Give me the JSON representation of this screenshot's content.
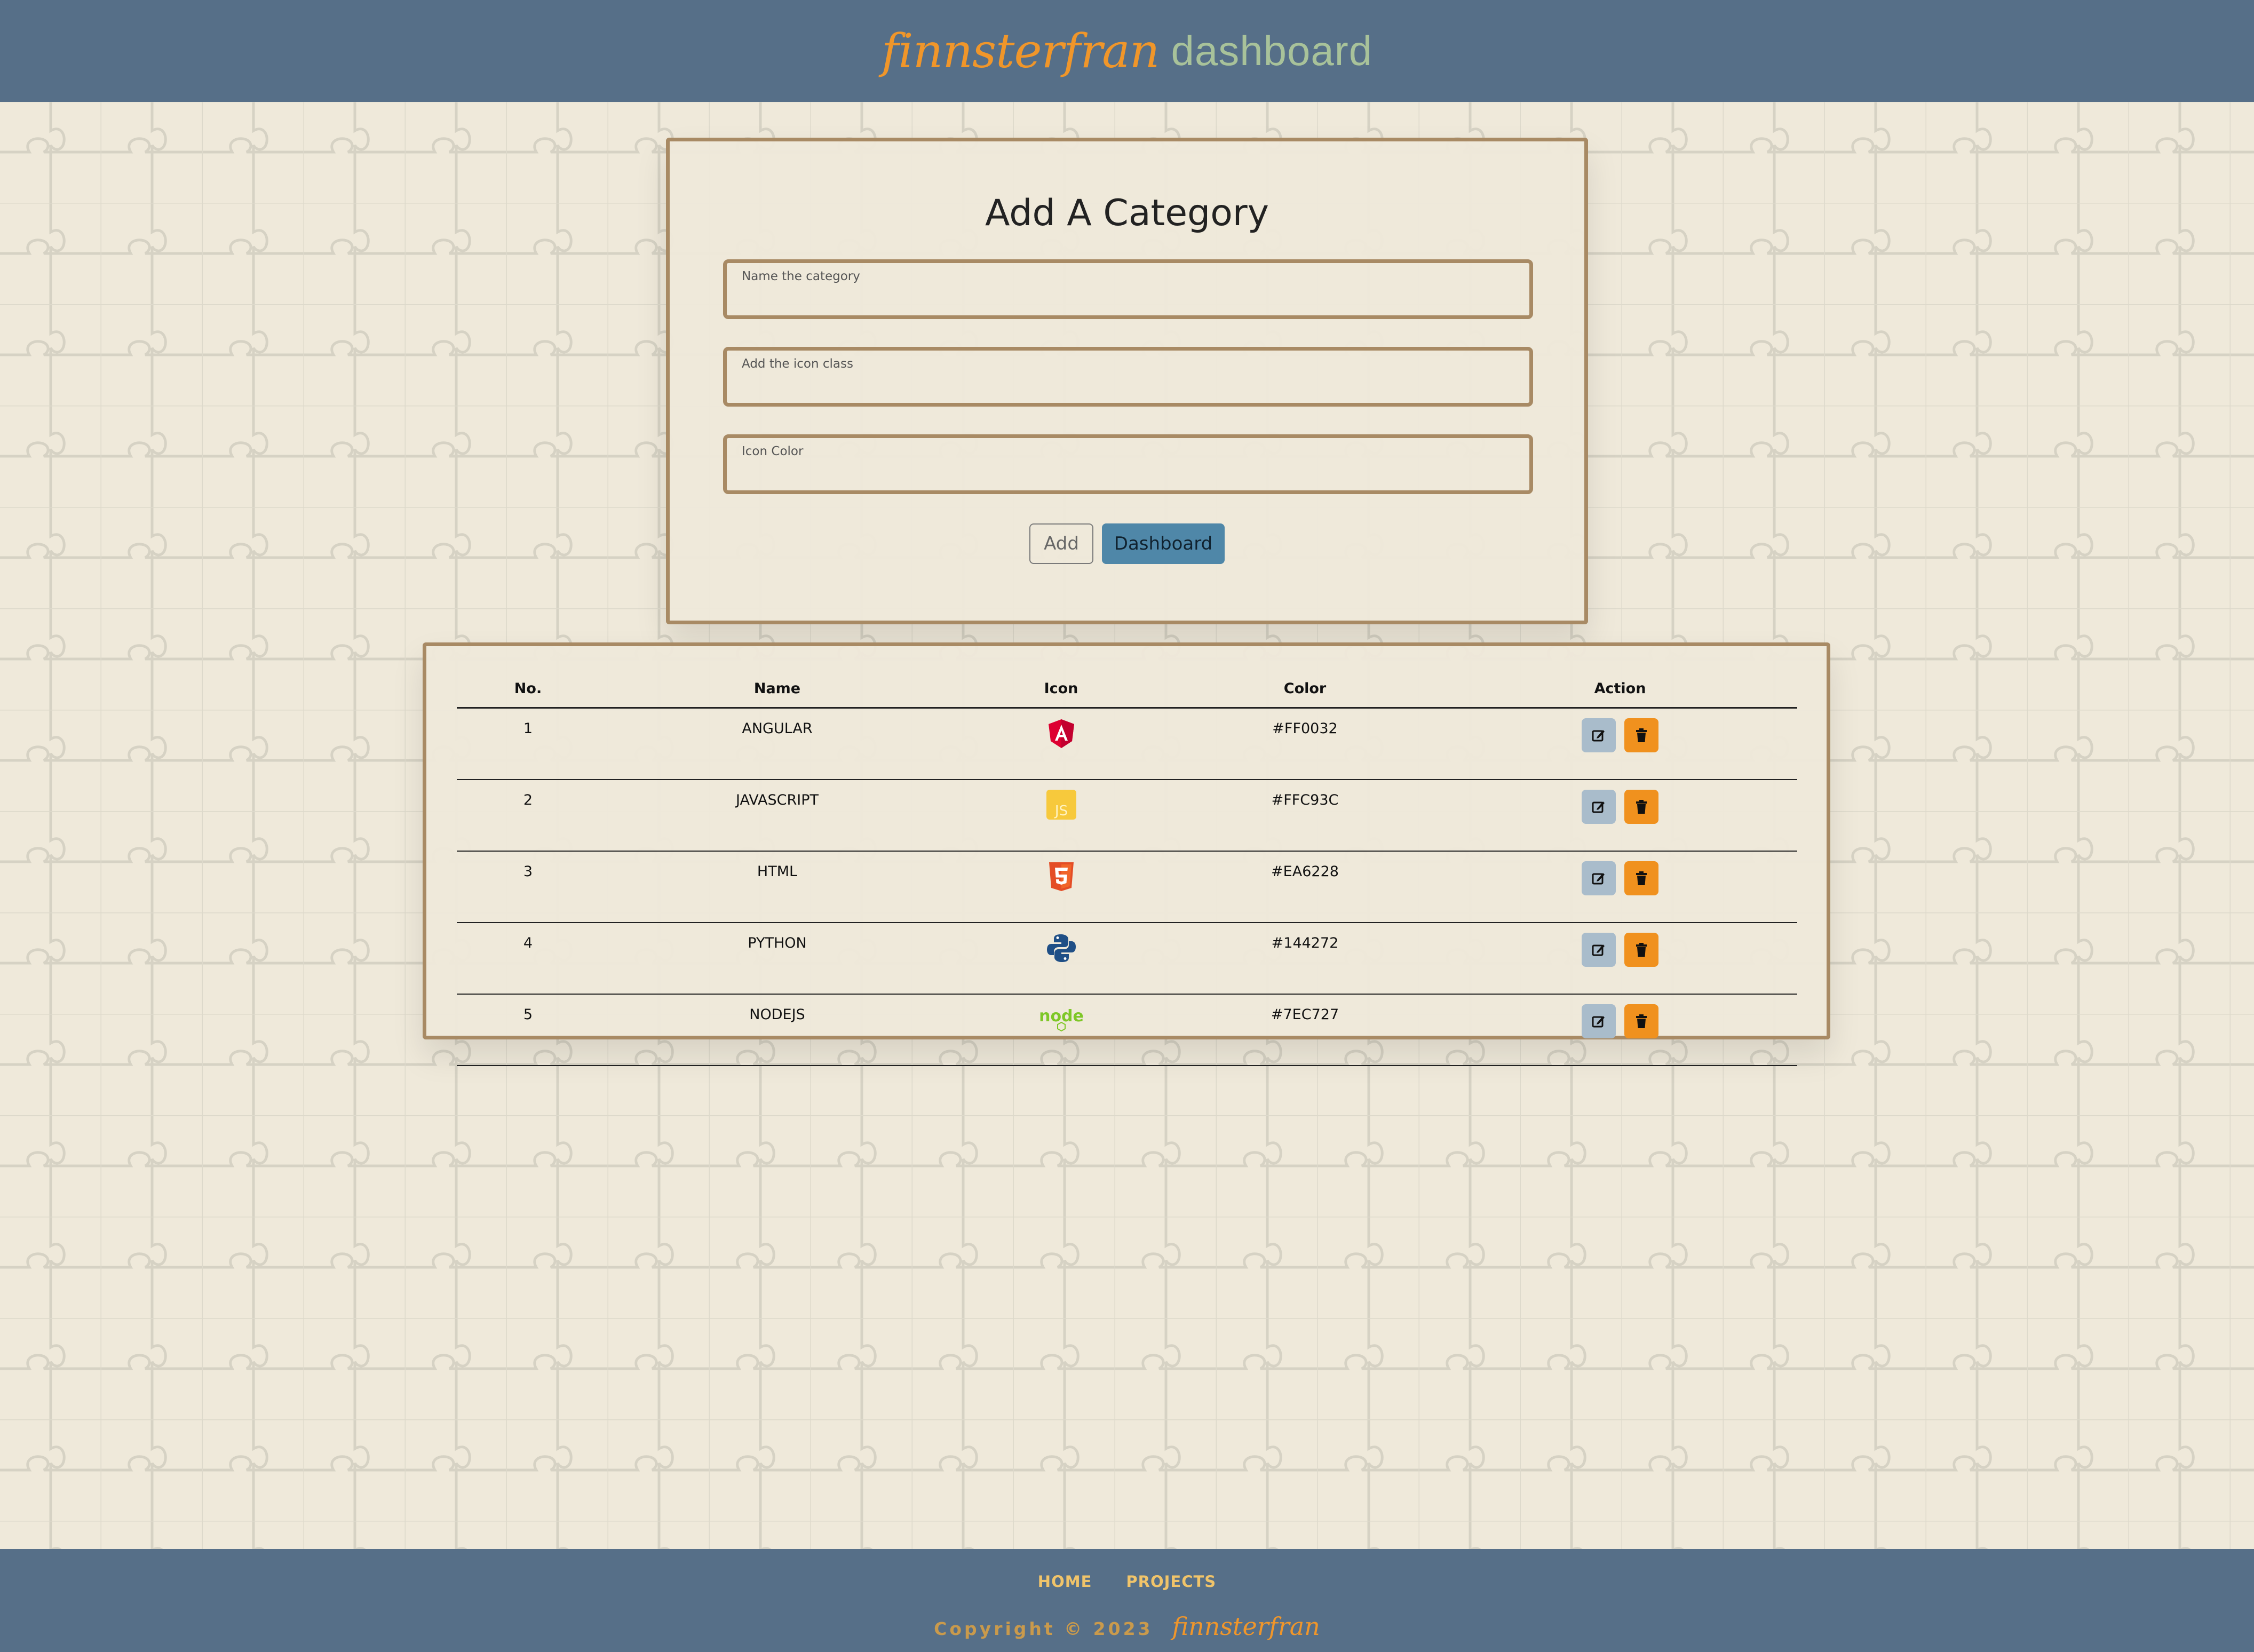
{
  "header": {
    "brand_script": "finnsterfran",
    "brand_word": "dashboard"
  },
  "form": {
    "title": "Add A Category",
    "fields": [
      {
        "label": "Name the category",
        "value": ""
      },
      {
        "label": "Add the icon class",
        "value": ""
      },
      {
        "label": "Icon Color",
        "value": ""
      }
    ],
    "add_label": "Add",
    "dashboard_label": "Dashboard"
  },
  "table": {
    "headers": [
      "No.",
      "Name",
      "Icon",
      "Color",
      "Action"
    ],
    "rows": [
      {
        "no": "1",
        "name": "ANGULAR",
        "icon": "angular-icon",
        "color": "#FF0032"
      },
      {
        "no": "2",
        "name": "JAVASCRIPT",
        "icon": "javascript-icon",
        "color": "#FFC93C"
      },
      {
        "no": "3",
        "name": "HTML",
        "icon": "html5-icon",
        "color": "#EA6228"
      },
      {
        "no": "4",
        "name": "PYTHON",
        "icon": "python-icon",
        "color": "#144272"
      },
      {
        "no": "5",
        "name": "NODEJS",
        "icon": "nodejs-icon",
        "color": "#7EC727"
      }
    ],
    "actions": {
      "edit_icon": "edit-icon",
      "delete_icon": "trash-icon"
    }
  },
  "footer": {
    "links": [
      "HOME",
      "PROJECTS"
    ],
    "copyright": "Copyright © 2023",
    "brand": "finnsterfran"
  },
  "colors": {
    "bar": "#566f88",
    "accent_orange": "#f0962a",
    "card_border": "#a88a64",
    "button_blue": "#4f87a8",
    "page_bg": "#efe9da"
  }
}
